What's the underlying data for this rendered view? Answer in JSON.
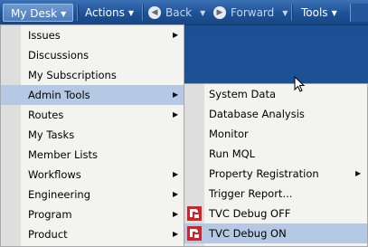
{
  "toolbar": {
    "mydesk": "My Desk",
    "actions": "Actions",
    "back": "Back",
    "forward": "Forward",
    "tools": "Tools",
    "caret": "▼"
  },
  "menu_main": {
    "items": [
      {
        "label": "Issues",
        "has_submenu": true
      },
      {
        "label": "Discussions",
        "has_submenu": false
      },
      {
        "label": "My Subscriptions",
        "has_submenu": false
      },
      {
        "label": "Admin Tools",
        "has_submenu": true,
        "highlighted": true
      },
      {
        "label": "Routes",
        "has_submenu": true
      },
      {
        "label": "My Tasks",
        "has_submenu": false
      },
      {
        "label": "Member Lists",
        "has_submenu": false
      },
      {
        "label": "Workflows",
        "has_submenu": true
      },
      {
        "label": "Engineering",
        "has_submenu": true
      },
      {
        "label": "Program",
        "has_submenu": true
      },
      {
        "label": "Product",
        "has_submenu": true
      }
    ]
  },
  "menu_admin": {
    "items": [
      {
        "label": "System Data",
        "has_submenu": false
      },
      {
        "label": "Database Analysis",
        "has_submenu": false
      },
      {
        "label": "Monitor",
        "has_submenu": false
      },
      {
        "label": "Run MQL",
        "has_submenu": false
      },
      {
        "label": "Property Registration",
        "has_submenu": true
      },
      {
        "label": "Trigger Report...",
        "has_submenu": false
      },
      {
        "label": "TVC Debug OFF",
        "has_submenu": false,
        "icon": "tvc-logo-icon"
      },
      {
        "label": "TVC Debug ON",
        "has_submenu": false,
        "icon": "tvc-logo-icon",
        "highlighted": true
      }
    ]
  },
  "colors": {
    "toolbar": "#1e5296",
    "menu_bg": "#f3f3f0",
    "highlight": "#b5c9e4",
    "tvc_red": "#d2232a"
  }
}
